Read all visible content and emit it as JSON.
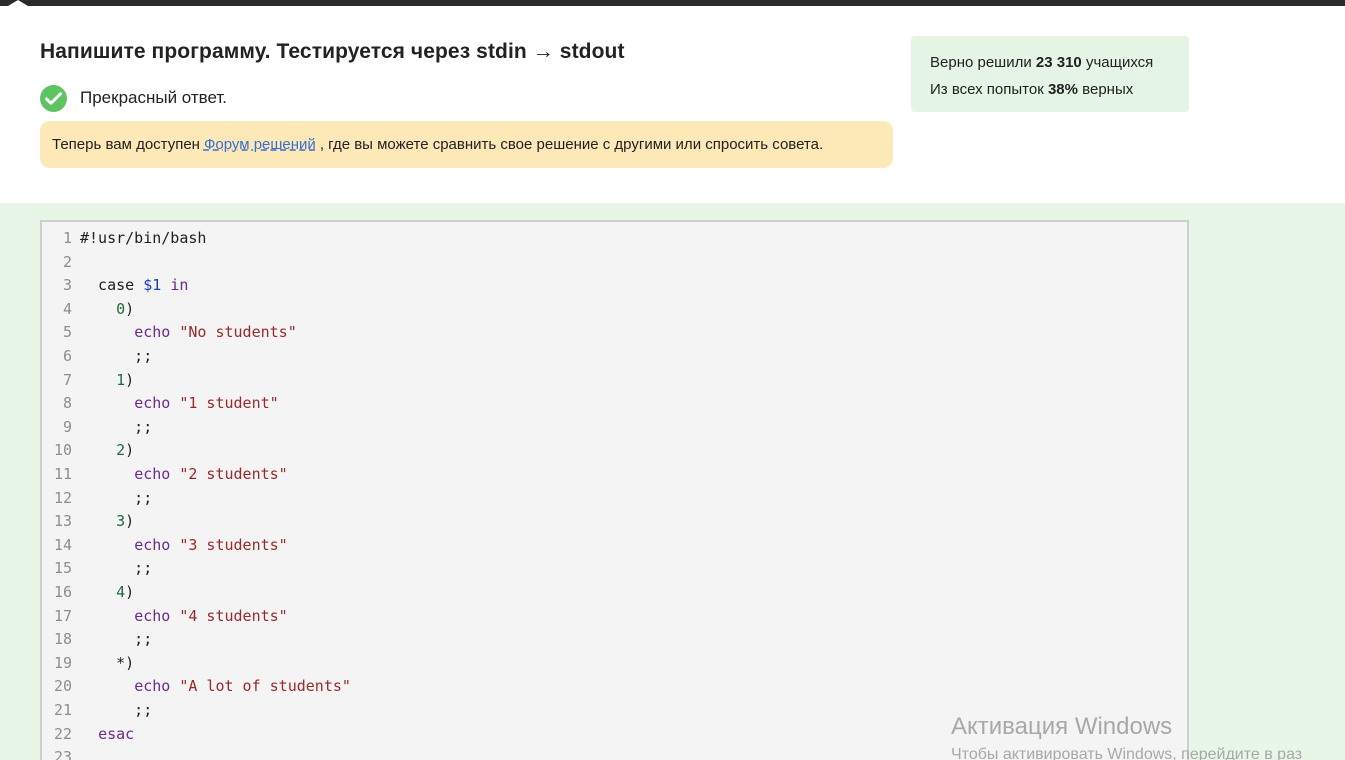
{
  "task": {
    "title": "Напишите программу. Тестируется через stdin → stdout",
    "result_text": "Прекрасный ответ."
  },
  "forum_note": {
    "before": "Теперь вам доступен",
    "link": "Форум решений",
    "after": ", где вы можете сравнить свое решение с другими или спросить совета."
  },
  "stats": {
    "solved_prefix": "Верно решили",
    "solved_count": "23 310",
    "solved_suffix": "учащихся",
    "attempts_prefix": "Из всех попыток",
    "attempts_percent": "38%",
    "attempts_suffix": "верных"
  },
  "code": {
    "lines": [
      {
        "no": "1",
        "tokens": [
          {
            "t": "#!usr/bin/bash",
            "c": "plain"
          }
        ]
      },
      {
        "no": "2",
        "tokens": []
      },
      {
        "no": "3",
        "tokens": [
          {
            "t": "  case ",
            "c": "plain"
          },
          {
            "t": "$1",
            "c": "var"
          },
          {
            "t": " ",
            "c": "plain"
          },
          {
            "t": "in",
            "c": "kw"
          }
        ]
      },
      {
        "no": "4",
        "tokens": [
          {
            "t": "    ",
            "c": "plain"
          },
          {
            "t": "0",
            "c": "num"
          },
          {
            "t": ")",
            "c": "plain"
          }
        ]
      },
      {
        "no": "5",
        "tokens": [
          {
            "t": "      ",
            "c": "plain"
          },
          {
            "t": "echo",
            "c": "kw"
          },
          {
            "t": " ",
            "c": "plain"
          },
          {
            "t": "\"No students\"",
            "c": "str"
          }
        ]
      },
      {
        "no": "6",
        "tokens": [
          {
            "t": "      ;;",
            "c": "plain"
          }
        ]
      },
      {
        "no": "7",
        "tokens": [
          {
            "t": "    ",
            "c": "plain"
          },
          {
            "t": "1",
            "c": "num"
          },
          {
            "t": ")",
            "c": "plain"
          }
        ]
      },
      {
        "no": "8",
        "tokens": [
          {
            "t": "      ",
            "c": "plain"
          },
          {
            "t": "echo",
            "c": "kw"
          },
          {
            "t": " ",
            "c": "plain"
          },
          {
            "t": "\"1 student\"",
            "c": "str"
          }
        ]
      },
      {
        "no": "9",
        "tokens": [
          {
            "t": "      ;;",
            "c": "plain"
          }
        ]
      },
      {
        "no": "10",
        "tokens": [
          {
            "t": "    ",
            "c": "plain"
          },
          {
            "t": "2",
            "c": "num"
          },
          {
            "t": ")",
            "c": "plain"
          }
        ]
      },
      {
        "no": "11",
        "tokens": [
          {
            "t": "      ",
            "c": "plain"
          },
          {
            "t": "echo",
            "c": "kw"
          },
          {
            "t": " ",
            "c": "plain"
          },
          {
            "t": "\"2 students\"",
            "c": "str"
          }
        ]
      },
      {
        "no": "12",
        "tokens": [
          {
            "t": "      ;;",
            "c": "plain"
          }
        ]
      },
      {
        "no": "13",
        "tokens": [
          {
            "t": "    ",
            "c": "plain"
          },
          {
            "t": "3",
            "c": "num"
          },
          {
            "t": ")",
            "c": "plain"
          }
        ]
      },
      {
        "no": "14",
        "tokens": [
          {
            "t": "      ",
            "c": "plain"
          },
          {
            "t": "echo",
            "c": "kw"
          },
          {
            "t": " ",
            "c": "plain"
          },
          {
            "t": "\"3 students\"",
            "c": "str"
          }
        ]
      },
      {
        "no": "15",
        "tokens": [
          {
            "t": "      ;;",
            "c": "plain"
          }
        ]
      },
      {
        "no": "16",
        "tokens": [
          {
            "t": "    ",
            "c": "plain"
          },
          {
            "t": "4",
            "c": "num"
          },
          {
            "t": ")",
            "c": "plain"
          }
        ]
      },
      {
        "no": "17",
        "tokens": [
          {
            "t": "      ",
            "c": "plain"
          },
          {
            "t": "echo",
            "c": "kw"
          },
          {
            "t": " ",
            "c": "plain"
          },
          {
            "t": "\"4 students\"",
            "c": "str"
          }
        ]
      },
      {
        "no": "18",
        "tokens": [
          {
            "t": "      ;;",
            "c": "plain"
          }
        ]
      },
      {
        "no": "19",
        "tokens": [
          {
            "t": "    *)",
            "c": "plain"
          }
        ]
      },
      {
        "no": "20",
        "tokens": [
          {
            "t": "      ",
            "c": "plain"
          },
          {
            "t": "echo",
            "c": "kw"
          },
          {
            "t": " ",
            "c": "plain"
          },
          {
            "t": "\"A lot of students\"",
            "c": "str"
          }
        ]
      },
      {
        "no": "21",
        "tokens": [
          {
            "t": "      ;;",
            "c": "plain"
          }
        ]
      },
      {
        "no": "22",
        "tokens": [
          {
            "t": "  ",
            "c": "plain"
          },
          {
            "t": "esac",
            "c": "kw"
          }
        ]
      },
      {
        "no": "23",
        "tokens": []
      }
    ]
  },
  "watermark": {
    "title": "Активация Windows",
    "subtitle": "Чтобы активировать Windows, перейдите в раз"
  },
  "icons": {
    "check": "check-circle-icon"
  },
  "colors": {
    "success": "#5ec463",
    "note_bg": "#fde9b8",
    "stats_bg": "#e4f5e5",
    "editor_area_bg": "#e7f6e7",
    "link": "#3a6fd0"
  }
}
